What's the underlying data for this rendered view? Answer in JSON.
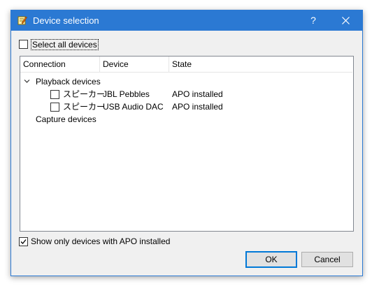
{
  "window": {
    "title": "Device selection",
    "help_glyph": "?",
    "title_icon": "notepad-icon"
  },
  "select_all": {
    "label": "Select all devices",
    "checked": false
  },
  "table": {
    "columns": [
      "Connection",
      "Device",
      "State"
    ],
    "groups": [
      {
        "label": "Playback devices",
        "expanded": true,
        "items": [
          {
            "connection": "スピーカー",
            "device": "JBL Pebbles",
            "state": "APO installed",
            "checked": false
          },
          {
            "connection": "スピーカー",
            "device": "USB Audio DAC",
            "state": "APO installed",
            "checked": false
          }
        ]
      },
      {
        "label": "Capture devices",
        "expanded": false,
        "items": []
      }
    ]
  },
  "show_only": {
    "label": "Show only devices with APO installed",
    "checked": true
  },
  "buttons": {
    "ok": "OK",
    "cancel": "Cancel"
  },
  "colors": {
    "titlebar": "#2b79d3",
    "default_button_border": "#0078d7"
  }
}
